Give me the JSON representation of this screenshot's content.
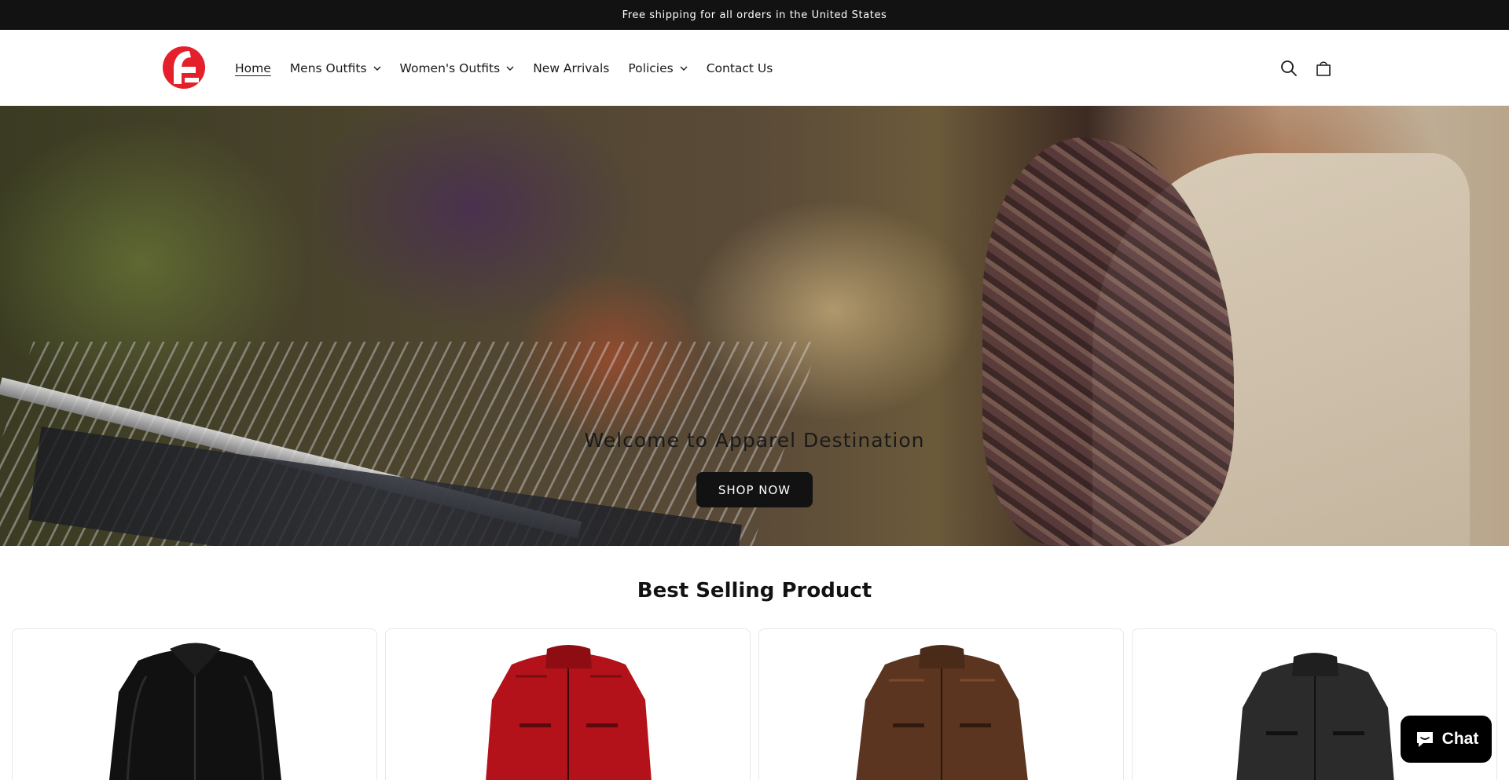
{
  "announcement": {
    "text": "Free shipping for all orders in the United States"
  },
  "header": {
    "logo_icon": "apparel-destination-logo",
    "nav": [
      {
        "label": "Home",
        "active": true,
        "has_dropdown": false
      },
      {
        "label": "Mens Outfits",
        "active": false,
        "has_dropdown": true
      },
      {
        "label": "Women's Outfits",
        "active": false,
        "has_dropdown": true
      },
      {
        "label": "New Arrivals",
        "active": false,
        "has_dropdown": false
      },
      {
        "label": "Policies",
        "active": false,
        "has_dropdown": true
      },
      {
        "label": "Contact Us",
        "active": false,
        "has_dropdown": false
      }
    ],
    "icons": [
      "search-icon",
      "cart-icon"
    ]
  },
  "hero": {
    "title": "Welcome to Apparel Destination",
    "button_label": "SHOP NOW"
  },
  "best_selling": {
    "title": "Best Selling Product",
    "products": [
      {
        "image": "black-leather-jacket"
      },
      {
        "image": "red-leather-jacket"
      },
      {
        "image": "brown-leather-jacket"
      },
      {
        "image": "dark-grey-leather-jacket"
      }
    ]
  },
  "chat": {
    "label": "Chat",
    "icon": "chat-bubble-icon"
  },
  "colors": {
    "brand_red": "#e4202a",
    "dark": "#121212",
    "white": "#ffffff"
  }
}
